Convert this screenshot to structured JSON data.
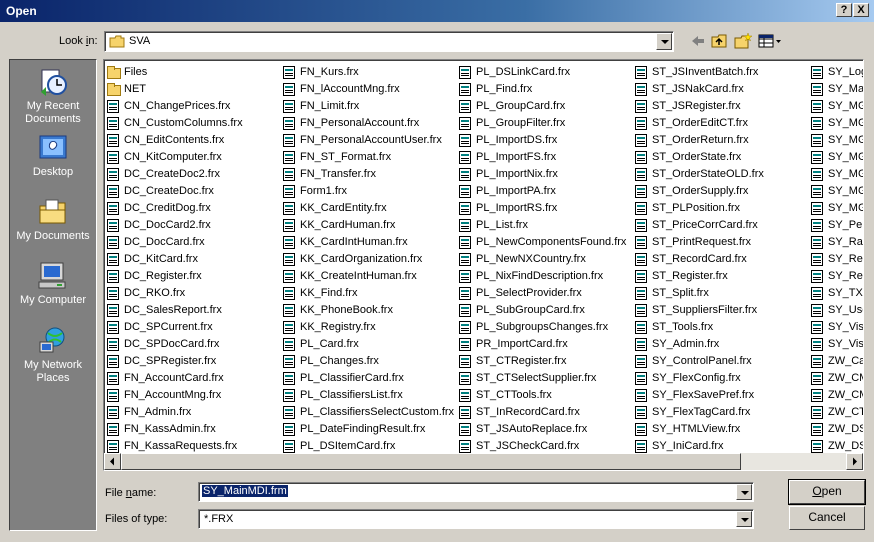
{
  "window": {
    "title": "Open",
    "help_btn": "?",
    "close_btn": "X"
  },
  "lookin": {
    "label_pre": "Look ",
    "label_accel": "i",
    "label_post": "n:",
    "value": "SVA"
  },
  "places": [
    {
      "name": "my-recent-documents",
      "line1": "My Recent",
      "line2": "Documents"
    },
    {
      "name": "desktop",
      "line1": "Desktop",
      "line2": ""
    },
    {
      "name": "my-documents",
      "line1": "My Documents",
      "line2": ""
    },
    {
      "name": "my-computer",
      "line1": "My Computer",
      "line2": ""
    },
    {
      "name": "my-network-places",
      "line1": "My Network",
      "line2": "Places"
    }
  ],
  "files": {
    "col0": [
      {
        "name": "Files",
        "type": "folder"
      },
      {
        "name": "NET",
        "type": "folder"
      },
      {
        "name": "CN_ChangePrices.frx",
        "type": "file"
      },
      {
        "name": "CN_CustomColumns.frx",
        "type": "file"
      },
      {
        "name": "CN_EditContents.frx",
        "type": "file"
      },
      {
        "name": "CN_KitComputer.frx",
        "type": "file"
      },
      {
        "name": "DC_CreateDoc2.frx",
        "type": "file"
      },
      {
        "name": "DC_CreateDoc.frx",
        "type": "file"
      },
      {
        "name": "DC_CreditDog.frx",
        "type": "file"
      },
      {
        "name": "DC_DocCard2.frx",
        "type": "file"
      },
      {
        "name": "DC_DocCard.frx",
        "type": "file"
      },
      {
        "name": "DC_KitCard.frx",
        "type": "file"
      },
      {
        "name": "DC_Register.frx",
        "type": "file"
      },
      {
        "name": "DC_RKO.frx",
        "type": "file"
      },
      {
        "name": "DC_SalesReport.frx",
        "type": "file"
      },
      {
        "name": "DC_SPCurrent.frx",
        "type": "file"
      },
      {
        "name": "DC_SPDocCard.frx",
        "type": "file"
      },
      {
        "name": "DC_SPRegister.frx",
        "type": "file"
      },
      {
        "name": "FN_AccountCard.frx",
        "type": "file"
      },
      {
        "name": "FN_AccountMng.frx",
        "type": "file"
      },
      {
        "name": "FN_Admin.frx",
        "type": "file"
      },
      {
        "name": "FN_KassAdmin.frx",
        "type": "file"
      },
      {
        "name": "FN_KassaRequests.frx",
        "type": "file"
      }
    ],
    "col1": [
      {
        "name": "FN_Kurs.frx",
        "type": "file"
      },
      {
        "name": "FN_lAccountMng.frx",
        "type": "file"
      },
      {
        "name": "FN_Limit.frx",
        "type": "file"
      },
      {
        "name": "FN_PersonalAccount.frx",
        "type": "file"
      },
      {
        "name": "FN_PersonalAccountUser.frx",
        "type": "file"
      },
      {
        "name": "FN_ST_Format.frx",
        "type": "file"
      },
      {
        "name": "FN_Transfer.frx",
        "type": "file"
      },
      {
        "name": "Form1.frx",
        "type": "file"
      },
      {
        "name": "KK_CardEntity.frx",
        "type": "file"
      },
      {
        "name": "KK_CardHuman.frx",
        "type": "file"
      },
      {
        "name": "KK_CardIntHuman.frx",
        "type": "file"
      },
      {
        "name": "KK_CardOrganization.frx",
        "type": "file"
      },
      {
        "name": "KK_CreateIntHuman.frx",
        "type": "file"
      },
      {
        "name": "KK_Find.frx",
        "type": "file"
      },
      {
        "name": "KK_PhoneBook.frx",
        "type": "file"
      },
      {
        "name": "KK_Registry.frx",
        "type": "file"
      },
      {
        "name": "PL_Card.frx",
        "type": "file"
      },
      {
        "name": "PL_Changes.frx",
        "type": "file"
      },
      {
        "name": "PL_ClassifierCard.frx",
        "type": "file"
      },
      {
        "name": "PL_ClassifiersList.frx",
        "type": "file"
      },
      {
        "name": "PL_ClassifiersSelectCustom.frx",
        "type": "file"
      },
      {
        "name": "PL_DateFindingResult.frx",
        "type": "file"
      },
      {
        "name": "PL_DSItemCard.frx",
        "type": "file"
      }
    ],
    "col2": [
      {
        "name": "PL_DSLinkCard.frx",
        "type": "file"
      },
      {
        "name": "PL_Find.frx",
        "type": "file"
      },
      {
        "name": "PL_GroupCard.frx",
        "type": "file"
      },
      {
        "name": "PL_GroupFilter.frx",
        "type": "file"
      },
      {
        "name": "PL_ImportDS.frx",
        "type": "file"
      },
      {
        "name": "PL_ImportFS.frx",
        "type": "file"
      },
      {
        "name": "PL_ImportNix.frx",
        "type": "file"
      },
      {
        "name": "PL_ImportPA.frx",
        "type": "file"
      },
      {
        "name": "PL_ImportRS.frx",
        "type": "file"
      },
      {
        "name": "PL_List.frx",
        "type": "file"
      },
      {
        "name": "PL_NewComponentsFound.frx",
        "type": "file"
      },
      {
        "name": "PL_NewNXCountry.frx",
        "type": "file"
      },
      {
        "name": "PL_NixFindDescription.frx",
        "type": "file"
      },
      {
        "name": "PL_SelectProvider.frx",
        "type": "file"
      },
      {
        "name": "PL_SubGroupCard.frx",
        "type": "file"
      },
      {
        "name": "PL_SubgroupsChanges.frx",
        "type": "file"
      },
      {
        "name": "PR_ImportCard.frx",
        "type": "file"
      },
      {
        "name": "ST_CTRegister.frx",
        "type": "file"
      },
      {
        "name": "ST_CTSelectSupplier.frx",
        "type": "file"
      },
      {
        "name": "ST_CTTools.frx",
        "type": "file"
      },
      {
        "name": "ST_InRecordCard.frx",
        "type": "file"
      },
      {
        "name": "ST_JSAutoReplace.frx",
        "type": "file"
      },
      {
        "name": "ST_JSCheckCard.frx",
        "type": "file"
      }
    ],
    "col3": [
      {
        "name": "ST_JSInventBatch.frx",
        "type": "file"
      },
      {
        "name": "ST_JSNakCard.frx",
        "type": "file"
      },
      {
        "name": "ST_JSRegister.frx",
        "type": "file"
      },
      {
        "name": "ST_OrderEditCT.frx",
        "type": "file"
      },
      {
        "name": "ST_OrderReturn.frx",
        "type": "file"
      },
      {
        "name": "ST_OrderState.frx",
        "type": "file"
      },
      {
        "name": "ST_OrderStateOLD.frx",
        "type": "file"
      },
      {
        "name": "ST_OrderSupply.frx",
        "type": "file"
      },
      {
        "name": "ST_PLPosition.frx",
        "type": "file"
      },
      {
        "name": "ST_PriceCorrCard.frx",
        "type": "file"
      },
      {
        "name": "ST_PrintRequest.frx",
        "type": "file"
      },
      {
        "name": "ST_RecordCard.frx",
        "type": "file"
      },
      {
        "name": "ST_Register.frx",
        "type": "file"
      },
      {
        "name": "ST_Split.frx",
        "type": "file"
      },
      {
        "name": "ST_SuppliersFilter.frx",
        "type": "file"
      },
      {
        "name": "ST_Tools.frx",
        "type": "file"
      },
      {
        "name": "SY_Admin.frx",
        "type": "file"
      },
      {
        "name": "SY_ControlPanel.frx",
        "type": "file"
      },
      {
        "name": "SY_FlexConfig.frx",
        "type": "file"
      },
      {
        "name": "SY_FlexSavePref.frx",
        "type": "file"
      },
      {
        "name": "SY_FlexTagCard.frx",
        "type": "file"
      },
      {
        "name": "SY_HTMLView.frx",
        "type": "file"
      },
      {
        "name": "SY_IniCard.frx",
        "type": "file"
      }
    ],
    "col4": [
      {
        "name": "SY_Log",
        "type": "file"
      },
      {
        "name": "SY_Mai",
        "type": "file"
      },
      {
        "name": "SY_MG_",
        "type": "file"
      },
      {
        "name": "SY_MG",
        "type": "file"
      },
      {
        "name": "SY_MG",
        "type": "file"
      },
      {
        "name": "SY_MG",
        "type": "file"
      },
      {
        "name": "SY_MG",
        "type": "file"
      },
      {
        "name": "SY_MG",
        "type": "file"
      },
      {
        "name": "SY_MG",
        "type": "file"
      },
      {
        "name": "SY_Peri",
        "type": "file"
      },
      {
        "name": "SY_Rat",
        "type": "file"
      },
      {
        "name": "SY_Reg",
        "type": "file"
      },
      {
        "name": "SY_Rep",
        "type": "file"
      },
      {
        "name": "SY_TXT",
        "type": "file"
      },
      {
        "name": "SY_Use",
        "type": "file"
      },
      {
        "name": "SY_Visu",
        "type": "file"
      },
      {
        "name": "SY_Visu",
        "type": "file"
      },
      {
        "name": "ZW_Ca",
        "type": "file"
      },
      {
        "name": "ZW_CM",
        "type": "file"
      },
      {
        "name": "ZW_CM",
        "type": "file"
      },
      {
        "name": "ZW_CT",
        "type": "file"
      },
      {
        "name": "ZW_DS",
        "type": "file"
      },
      {
        "name": "ZW_DS",
        "type": "file"
      }
    ]
  },
  "filename": {
    "label_pre": "File ",
    "label_accel": "n",
    "label_post": "ame:",
    "value": "SY_MainMDI.frm"
  },
  "filetype": {
    "label": "Files of type:",
    "value": "*.FRX"
  },
  "buttons": {
    "open_accel": "O",
    "open_rest": "pen",
    "cancel": "Cancel"
  }
}
